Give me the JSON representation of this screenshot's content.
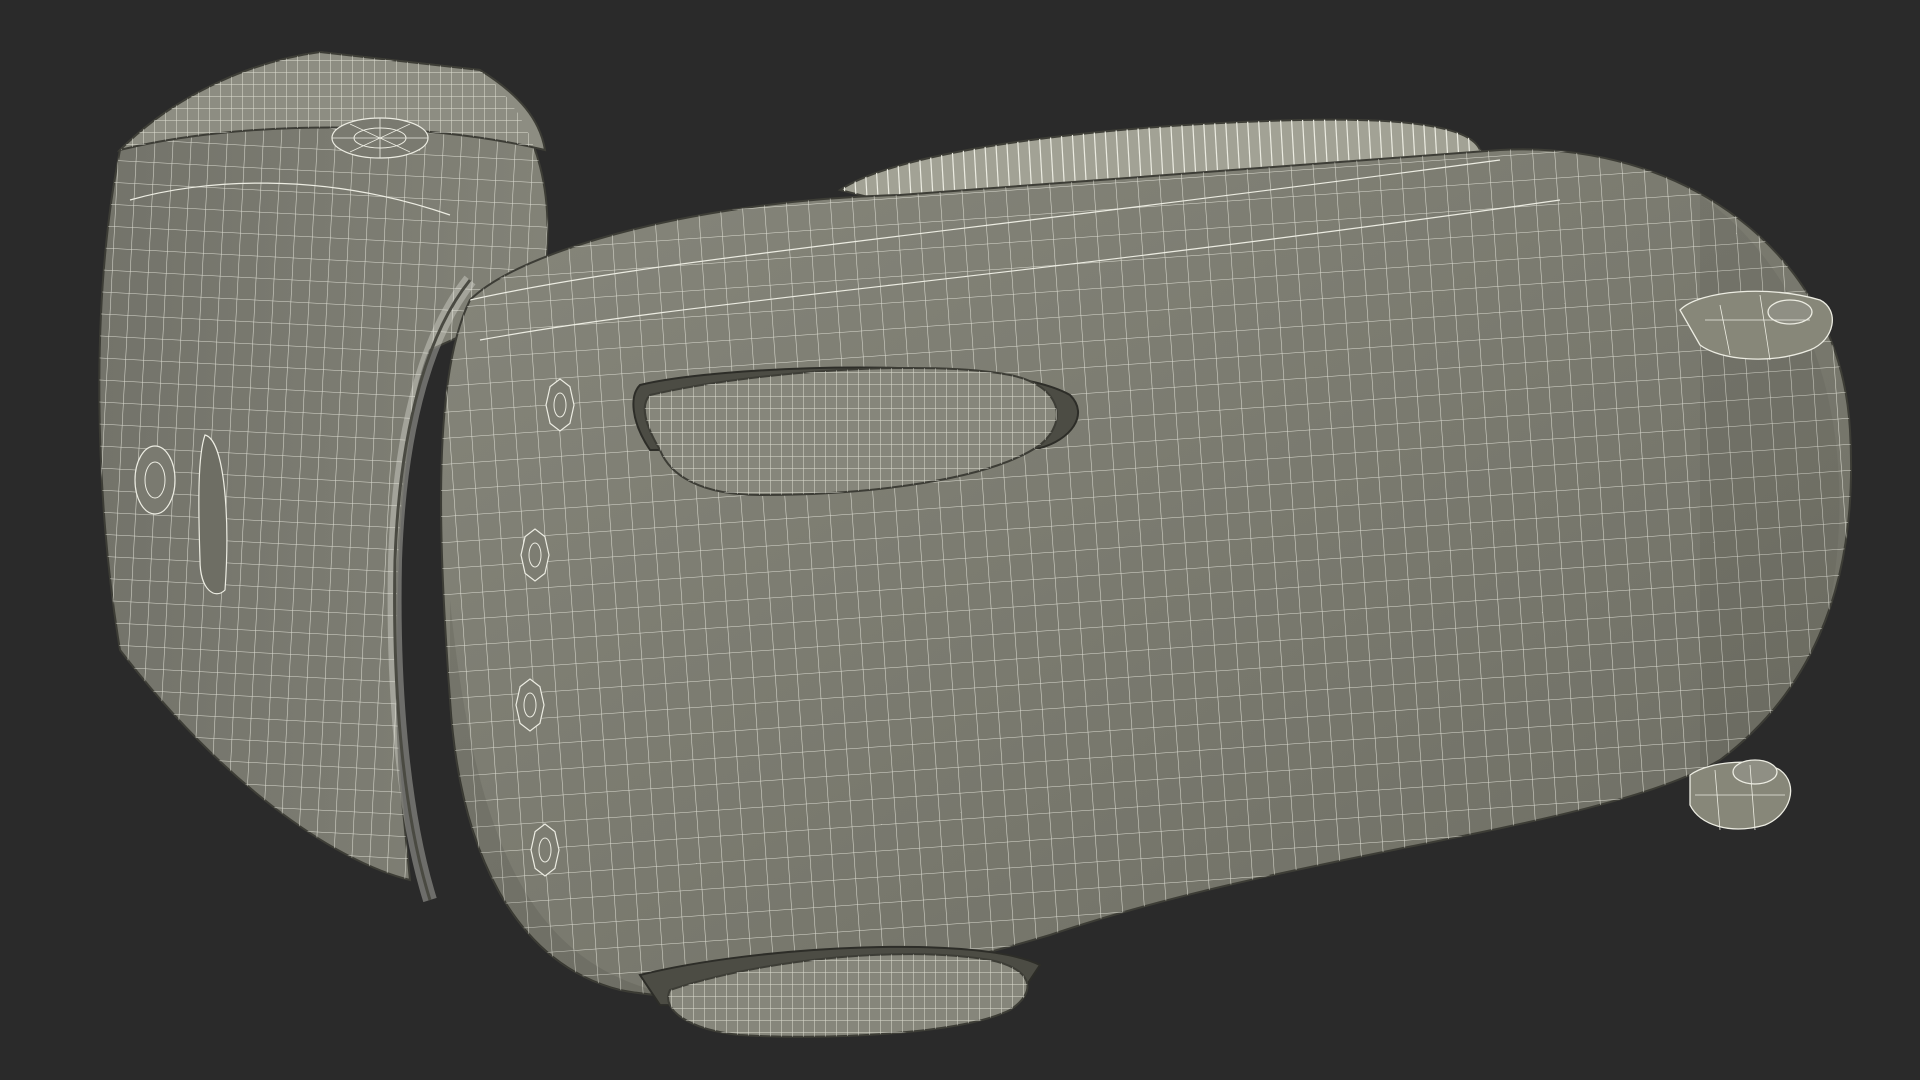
{
  "scene": {
    "subject": "wireframe-device-model",
    "colors": {
      "background": "#2a2a2a",
      "surface": "#7b7b70",
      "surface_dark": "#6c6c62",
      "surface_light": "#8a8a7e",
      "wire": "#e9e9df",
      "shadow": "#4a4a42"
    }
  }
}
